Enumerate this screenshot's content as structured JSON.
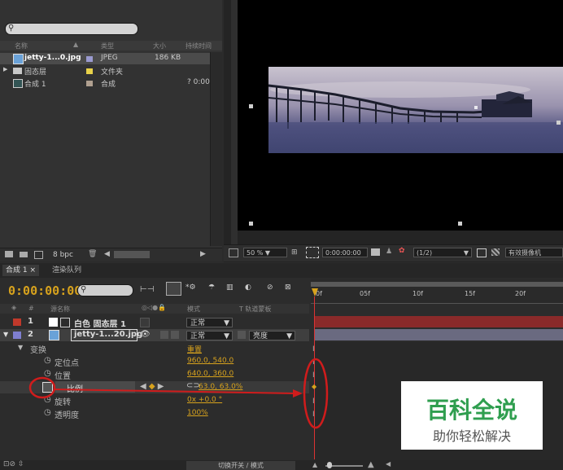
{
  "project": {
    "columns": {
      "name": "名称",
      "type": "类型",
      "size": "大小",
      "duration": "持续时间"
    },
    "items": [
      {
        "name": "jetty-1...0.jpg",
        "type": "JPEG",
        "size": "186 KB",
        "duration": "",
        "color": "#9a9ad0",
        "selected": true
      },
      {
        "name": "固态层",
        "type": "文件夹",
        "size": "",
        "duration": "",
        "color": "#e8d24a",
        "selected": false
      },
      {
        "name": "合成 1",
        "type": "合成",
        "size": "",
        "duration": "? 0:00",
        "color": "#b0a090",
        "selected": false
      }
    ],
    "bpc": "8 bpc"
  },
  "viewer": {
    "zoom": "50 %",
    "timecode": "0:00:00:00",
    "resolution": "(1/2)",
    "camera": "有效摄像机"
  },
  "timeline": {
    "tabs": [
      "合成 1",
      "渲染队列"
    ],
    "current_time": "0:00:00:00",
    "columns": {
      "num": "#",
      "source": "源名称",
      "mode": "模式",
      "trk": "T 轨道蒙板"
    },
    "layers": [
      {
        "num": "1",
        "name": "白色 固态层 1",
        "mode": "正常",
        "color": "#c0392b"
      },
      {
        "num": "2",
        "name": "jetty-1...20.jpg",
        "mode": "正常",
        "trkmat": "亮度",
        "color": "#7f7fd0"
      }
    ],
    "transform": {
      "label": "变换",
      "reset": "重置"
    },
    "props": [
      {
        "name": "定位点",
        "value": "960.0, 540.0"
      },
      {
        "name": "位置",
        "value": "640.0, 360.0"
      },
      {
        "name": "比例",
        "value": "63.0, 63.0%"
      },
      {
        "name": "旋转",
        "value": "0x +0.0 °"
      },
      {
        "name": "透明度",
        "value": "100%"
      }
    ],
    "ruler": [
      "0f",
      "05f",
      "10f",
      "15f",
      "20f"
    ],
    "footer": "切换开关 / 模式"
  },
  "watermark": {
    "title": "百科全说",
    "subtitle": "助你轻松解决"
  }
}
